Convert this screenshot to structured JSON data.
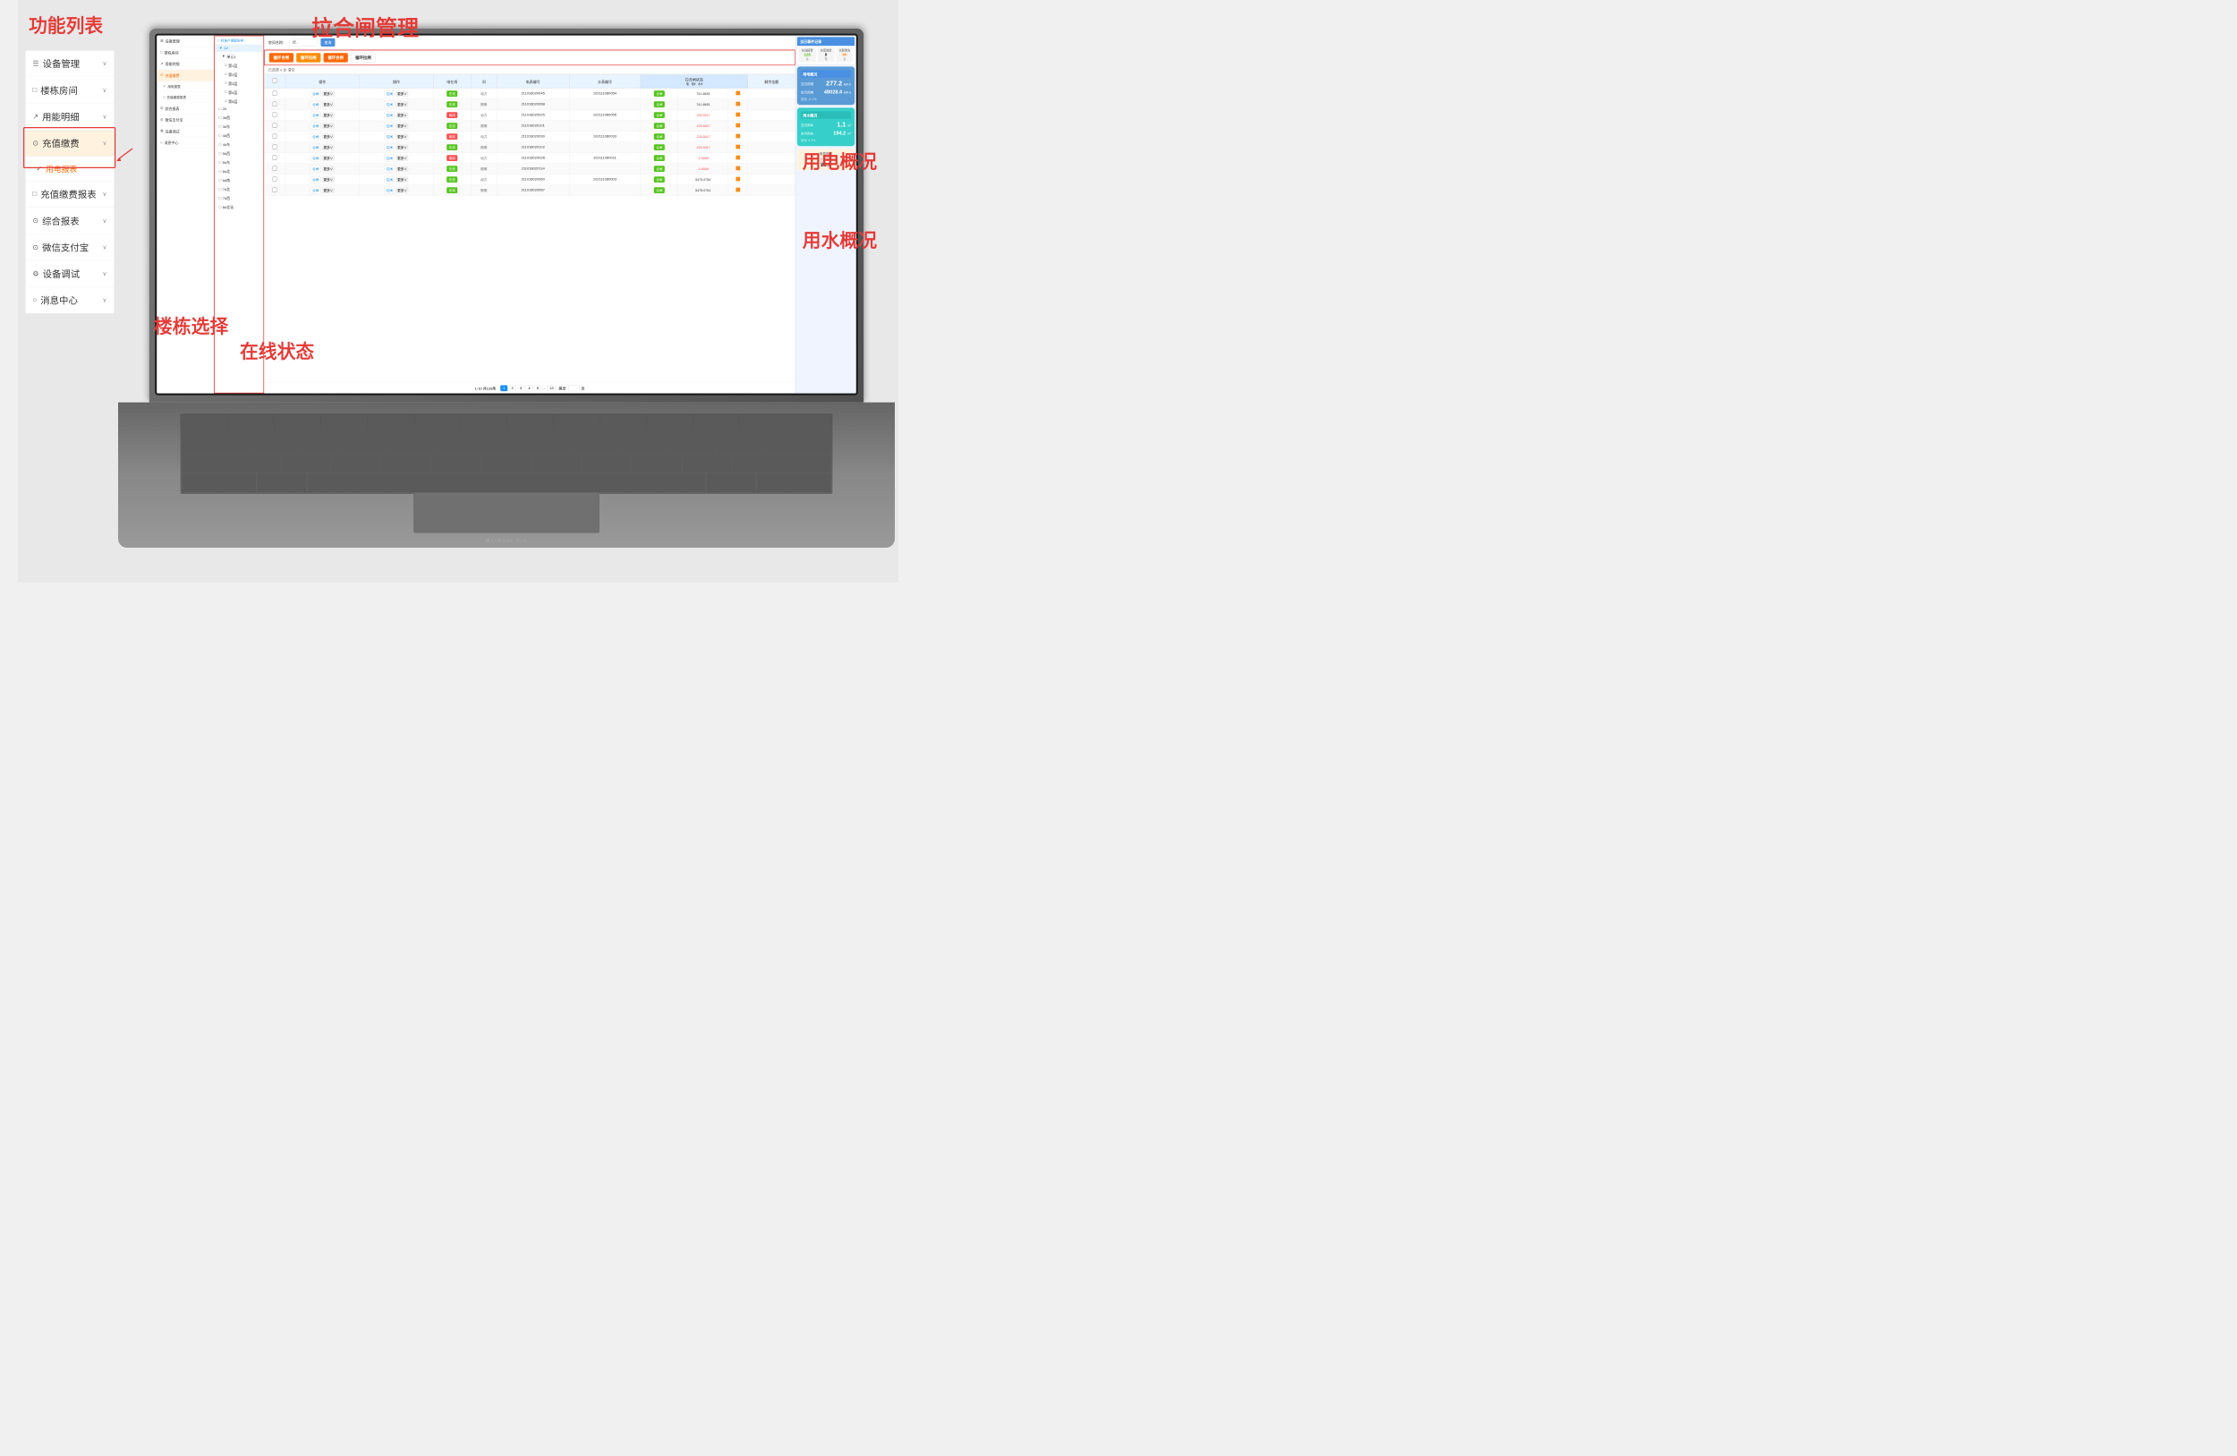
{
  "annotations": {
    "feature_list": "功能列表",
    "valve_management": "拉合闸管理",
    "building_selection": "楼栋选择",
    "online_status": "在线状态",
    "electricity_overview": "用电概况",
    "water_overview": "用水概况"
  },
  "sidebar": {
    "items": [
      {
        "id": "device",
        "icon": "☰",
        "label": "设备管理",
        "hasArrow": true
      },
      {
        "id": "building",
        "icon": "□",
        "label": "楼栋房间",
        "hasArrow": true
      },
      {
        "id": "usage",
        "icon": "↗",
        "label": "用能明细",
        "hasArrow": true
      },
      {
        "id": "recharge",
        "icon": "⊙",
        "label": "充值缴费",
        "hasArrow": true,
        "active": true
      },
      {
        "id": "report",
        "icon": "↗",
        "label": "用电报表",
        "hasArrow": true
      },
      {
        "id": "recharge_report",
        "icon": "□",
        "label": "充值缴费报表",
        "hasArrow": true
      },
      {
        "id": "comprehensive",
        "icon": "⊙",
        "label": "综合报表",
        "hasArrow": true
      },
      {
        "id": "wechat",
        "icon": "⊙",
        "label": "微信支付宝",
        "hasArrow": true
      },
      {
        "id": "device_test",
        "icon": "⚙",
        "label": "设备调试",
        "hasArrow": true
      },
      {
        "id": "message",
        "icon": "○",
        "label": "消息中心",
        "hasArrow": true
      }
    ]
  },
  "inner_sidebar": {
    "items": [
      {
        "icon": "☰",
        "label": "设备管理"
      },
      {
        "icon": "□",
        "label": "楼栋房间"
      },
      {
        "icon": "↗",
        "label": "用能明细"
      },
      {
        "icon": "⊙",
        "label": "充值缴费",
        "sub": [
          "用电报表",
          "充值缴费报表"
        ]
      },
      {
        "icon": "⊙",
        "label": "综合报表"
      },
      {
        "icon": "⊙",
        "label": "微信支付宝"
      },
      {
        "icon": "⚙",
        "label": "设备调试"
      },
      {
        "icon": "○",
        "label": "消息中心"
      }
    ]
  },
  "tree": {
    "root": "标准产城股份样板...",
    "buildings": [
      {
        "id": "1f",
        "label": "1#",
        "expanded": true,
        "units": [
          {
            "id": "unit1",
            "label": "单元1",
            "floors": [
              "第1层",
              "第2层",
              "第3层",
              "第4层",
              "第5层"
            ]
          }
        ]
      },
      {
        "id": "2f",
        "label": "2#"
      },
      {
        "id": "3w",
        "label": "3#西"
      },
      {
        "id": "3e",
        "label": "3#东"
      },
      {
        "id": "4n",
        "label": "4#西"
      },
      {
        "id": "4e",
        "label": "4#东"
      },
      {
        "id": "5w",
        "label": "5#西"
      },
      {
        "id": "5e",
        "label": "5#东"
      },
      {
        "id": "6n",
        "label": "6#北"
      },
      {
        "id": "6s",
        "label": "6#南"
      },
      {
        "id": "7n",
        "label": "7#北"
      },
      {
        "id": "7s",
        "label": "7#西"
      },
      {
        "id": "8n",
        "label": "8#北化"
      }
    ]
  },
  "header": {
    "search_placeholder": "搜...",
    "search_btn": "查询",
    "room_name_label": "房间名称："
  },
  "valve_buttons": [
    {
      "id": "open_valve",
      "label": "循环合闸",
      "style": "open"
    },
    {
      "id": "close_valve",
      "label": "循环拉闸",
      "style": "close"
    },
    {
      "id": "open_valve2",
      "label": "循环合闸",
      "style": "open"
    },
    {
      "id": "outline_btn",
      "label": "循环拉闸",
      "style": "outline"
    }
  ],
  "selection_info": "已选择 0 台  清空",
  "table": {
    "headers": [
      "",
      "操作",
      "操作",
      "电在线",
      "间",
      "电表编号",
      "水表编号",
      "拉合闸状态\n电  电¥  水¥",
      "剩余金额"
    ],
    "rows": [
      {
        "ops": [
          "合闸",
          "更多",
          "拉闸",
          "更多"
        ],
        "status": "在线",
        "type": "动力",
        "meter_e": "211018020045",
        "meter_w": "102111080054",
        "valve_e": "合闸",
        "amount_e": "741.4845",
        "amount_w_flag": "orange"
      },
      {
        "ops": [
          "合闸",
          "更多",
          "拉闸",
          "更多"
        ],
        "status": "在线",
        "type": "照明",
        "meter_e": "211018020068",
        "meter_w": "",
        "valve_e": "合闸",
        "amount_e": "741.4845",
        "amount_w_flag": "orange"
      },
      {
        "ops": [
          "合闸",
          "更多",
          "拉闸",
          "更多"
        ],
        "status": "离线",
        "type": "动力",
        "meter_e": "211018020025",
        "meter_w": "102111080055",
        "valve_e": "合闸",
        "amount_e": "-225.5417",
        "amount_w_flag": "orange"
      },
      {
        "ops": [
          "合闸",
          "更多",
          "拉闸",
          "更多"
        ],
        "status": "在线",
        "type": "照明",
        "meter_e": "211018020101",
        "meter_w": "",
        "valve_e": "合闸",
        "amount_e": "-225.5417",
        "amount_w_flag": "orange"
      },
      {
        "ops": [
          "合闸",
          "更多",
          "拉闸",
          "更多"
        ],
        "status": "离线",
        "type": "动力",
        "meter_e": "211018020030",
        "meter_w": "102111080033",
        "valve_e": "合闸",
        "amount_e": "-225.5417",
        "amount_w_flag": "orange"
      },
      {
        "ops": [
          "合闸",
          "更多",
          "拉闸",
          "更多"
        ],
        "status": "在线",
        "type": "照明",
        "meter_e": "211018020102",
        "meter_w": "",
        "valve_e": "合闸",
        "amount_e": "-225.5417",
        "amount_w_flag": "orange"
      },
      {
        "ops": [
          "合闸",
          "更多",
          "拉闸",
          "更多"
        ],
        "status": "离线",
        "type": "动力",
        "meter_e": "211018020028",
        "meter_w": "102111080011",
        "valve_e": "合闸",
        "amount_e": "-1.6508",
        "amount_w_flag": "orange"
      },
      {
        "ops": [
          "合闸",
          "更多",
          "拉闸",
          "更多"
        ],
        "status": "在线",
        "type": "照明",
        "meter_e": "211018020114",
        "meter_w": "",
        "valve_e": "合闸",
        "amount_e": "-1.6508",
        "amount_w_flag": "orange"
      },
      {
        "ops": [
          "合闸",
          "更多",
          "拉闸",
          "更多"
        ],
        "status": "在线",
        "type": "动力",
        "meter_e": "211018020060",
        "meter_w": "102111080003",
        "valve_e": "合闸",
        "amount_e": "5475.0754",
        "amount_w_flag": "orange"
      },
      {
        "ops": [
          "合闸",
          "更多",
          "拉闸",
          "更多"
        ],
        "status": "在线",
        "type": "照明",
        "meter_e": "211018020087",
        "meter_w": "",
        "valve_e": "合闸",
        "amount_e": "5475.0754",
        "amount_w_flag": "orange"
      }
    ]
  },
  "pagination": {
    "info": "1-10 共128条",
    "pages": [
      "1",
      "2",
      "3",
      "4",
      "5",
      "...",
      "13"
    ],
    "goto_label": "跳至",
    "page_unit": "页"
  },
  "right_panel": {
    "today_record_title": "当日事件记录",
    "stats": [
      {
        "label": "在线报警",
        "value": "128",
        "unit": "台",
        "color": "green"
      },
      {
        "label": "充值缴费",
        "value": "0",
        "unit": "笔",
        "color": "normal"
      },
      {
        "label": "失联警告",
        "value": "60",
        "unit": "台",
        "color": "orange"
      }
    ],
    "electricity": {
      "title": "用电概况",
      "today_label": "当日用电",
      "today_value": "277.2",
      "today_unit": "kW·h",
      "month_label": "本月用电",
      "month_value": "48028.4",
      "month_unit": "kW·h",
      "change_label": "变化",
      "change_value": "-0.1%"
    },
    "water": {
      "title": "用水概况",
      "today_label": "当日用水",
      "today_value": "1.1",
      "today_unit": "m³",
      "month_label": "本月用水",
      "month_value": "194.2",
      "month_unit": "m³",
      "change_label": "变化",
      "change_value": "0.2%"
    },
    "charge": {
      "title": "缴费概况",
      "today_label": "当日充值",
      "today_value": "¥0.0"
    }
  }
}
